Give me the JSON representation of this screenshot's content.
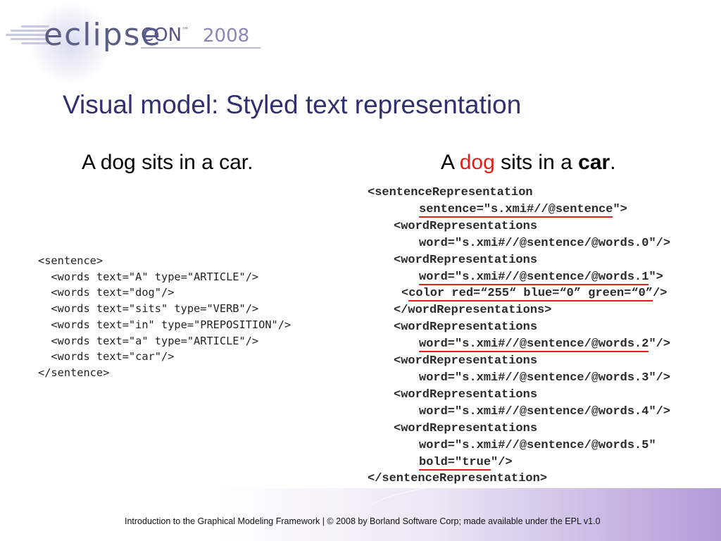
{
  "logo": {
    "eclipse": "eclipse",
    "con": "CON",
    "tm": "™",
    "year": "2008"
  },
  "slide": {
    "title": "Visual model: Styled text representation",
    "caption_left": "A dog sits in a car.",
    "caption_right": {
      "a": "A ",
      "dog": "dog",
      "middle": " sits in a ",
      "car": "car",
      "end": "."
    }
  },
  "code_left": {
    "lines": [
      "<sentence>",
      "  <words text=\"A\" type=\"ARTICLE\"/>",
      "  <words text=\"dog\"/>",
      "  <words text=\"sits\" type=\"VERB\"/>",
      "  <words text=\"in\" type=\"PREPOSITION\"/>",
      "  <words text=\"a\" type=\"ARTICLE\"/>",
      "  <words text=\"car\"/>",
      "</sentence>"
    ]
  },
  "code_right": {
    "l1": "<sentenceRepresentation",
    "l2_u": "sentence=\"s.xmi#//@sentence",
    "l2_t": "\">",
    "l3": "<wordRepresentations",
    "l4": "word=\"s.xmi#//@sentence/@words.0\"/>",
    "l5": "<wordRepresentations",
    "l6_u": "word=\"s.xmi#//@sentence/@words.1",
    "l6_t": "\">",
    "l7_lt": "<",
    "l7_u": "color red=“255“ blue=“0” green=“0”",
    "l7_t": "/>",
    "l8": "</wordRepresentations>",
    "l9": "<wordRepresentations",
    "l10_u": "word=\"s.xmi#//@sentence/@words.2",
    "l10_t": "\"/>",
    "l11": "<wordRepresentations",
    "l12": "word=\"s.xmi#//@sentence/@words.3\"/>",
    "l13": "<wordRepresentations",
    "l14": "word=\"s.xmi#//@sentence/@words.4\"/>",
    "l15": "<wordRepresentations",
    "l16": "word=\"s.xmi#//@sentence/@words.5\"",
    "l17_u": "bold=\"true",
    "l17_t": "\"/>",
    "l18": "</sentenceRepresentation>"
  },
  "footer": {
    "text": "Introduction to the Graphical Modeling Framework  |  © 2008 by Borland Software Corp; made available under the EPL v1.0"
  },
  "colors": {
    "title": "#30306e",
    "highlight_red": "#e0201b",
    "logo": "#5b5f86"
  }
}
